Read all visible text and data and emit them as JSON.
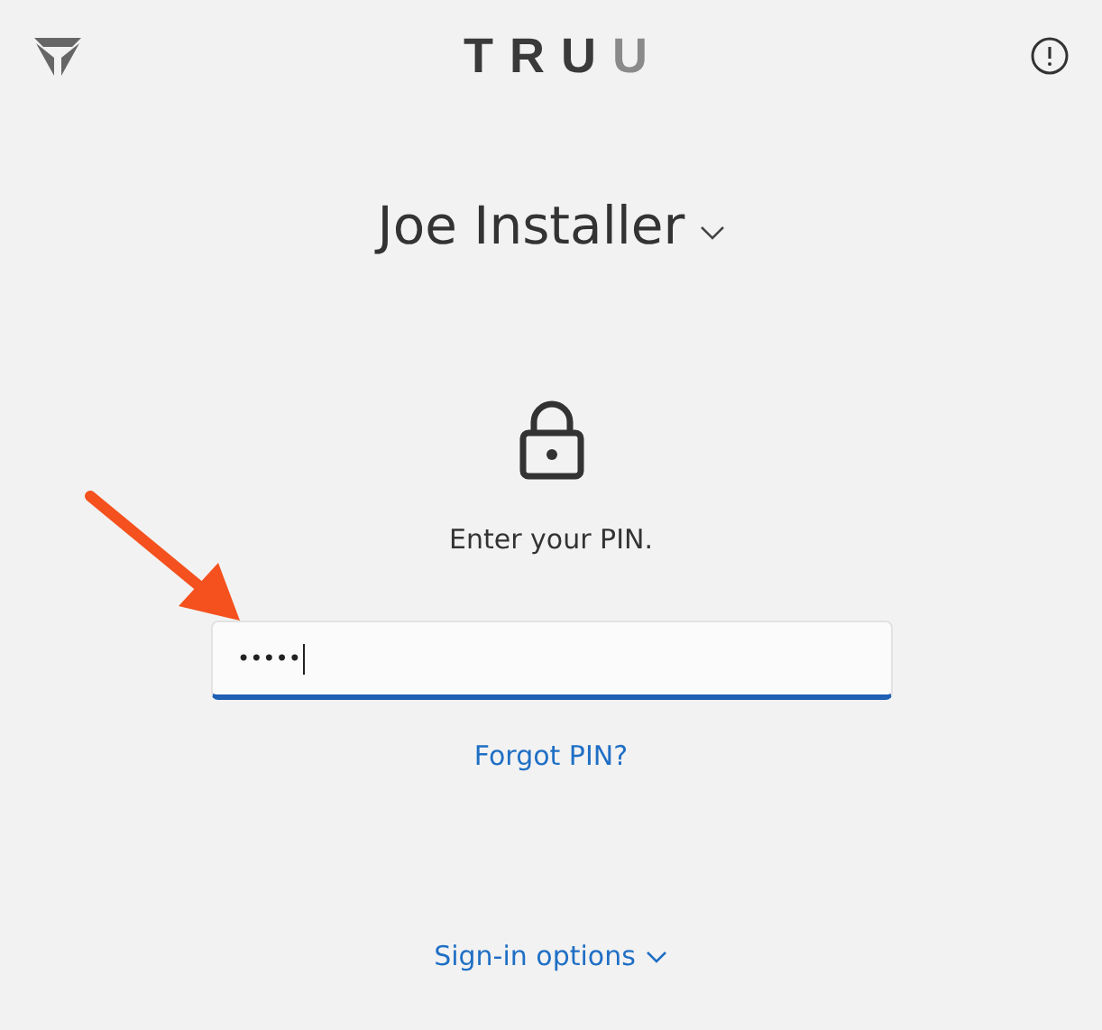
{
  "logo": [
    {
      "text": "TRU",
      "muted": false
    },
    {
      "text": "U",
      "muted": true
    }
  ],
  "account": {
    "name": "Joe Installer",
    "expanded": false
  },
  "prompt": "Enter your PIN.",
  "pin_field": {
    "value": "•••••",
    "focused": true
  },
  "forgot_link": "Forgot PIN?",
  "sign_in_options": {
    "label": "Sign-in options",
    "expanded": false
  },
  "annotation": {
    "kind": "arrow",
    "color": "#f4511e"
  }
}
